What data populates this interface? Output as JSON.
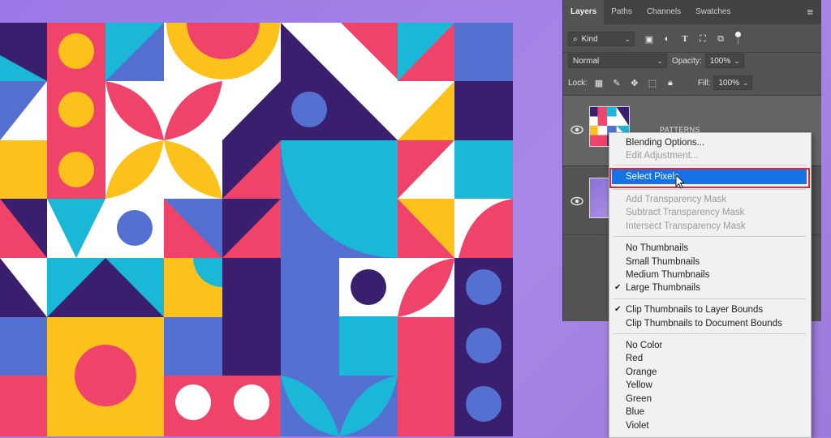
{
  "layers_panel": {
    "tabs": [
      "Layers",
      "Paths",
      "Channels",
      "Swatches"
    ],
    "filter": {
      "label": "Kind"
    },
    "blend_mode": "Normal",
    "opacity": {
      "label": "Opacity:",
      "value": "100%"
    },
    "lock_label": "Lock:",
    "fill": {
      "label": "Fill:",
      "value": "100%"
    },
    "layers": [
      {
        "name": "PATTERNS",
        "visible": true
      },
      {
        "name": "",
        "visible": true
      }
    ]
  },
  "context_menu": {
    "items": [
      {
        "label": "Blending Options...",
        "enabled": true
      },
      {
        "label": "Edit Adjustment...",
        "enabled": false
      },
      {
        "label": "Select Pixels",
        "enabled": true,
        "highlighted": true
      },
      {
        "label": "Add Transparency Mask",
        "enabled": false
      },
      {
        "label": "Subtract Transparency Mask",
        "enabled": false
      },
      {
        "label": "Intersect Transparency Mask",
        "enabled": false
      },
      {
        "label": "No Thumbnails",
        "enabled": true
      },
      {
        "label": "Small Thumbnails",
        "enabled": true
      },
      {
        "label": "Medium Thumbnails",
        "enabled": true
      },
      {
        "label": "Large Thumbnails",
        "enabled": true,
        "checked": true
      },
      {
        "label": "Clip Thumbnails to Layer Bounds",
        "enabled": true,
        "checked": true
      },
      {
        "label": "Clip Thumbnails to Document Bounds",
        "enabled": true
      },
      {
        "label": "No Color",
        "enabled": true
      },
      {
        "label": "Red",
        "enabled": true
      },
      {
        "label": "Orange",
        "enabled": true
      },
      {
        "label": "Yellow",
        "enabled": true
      },
      {
        "label": "Green",
        "enabled": true
      },
      {
        "label": "Blue",
        "enabled": true
      },
      {
        "label": "Violet",
        "enabled": true
      }
    ]
  },
  "colors": {
    "highlight": "#1473e6",
    "highlight_outline": "#e8243b",
    "pattern_pink": "#f0436a",
    "pattern_yellow": "#fcc21b",
    "pattern_cyan": "#1bb7d6",
    "pattern_navy": "#3a1f6e",
    "pattern_blue": "#5470d0",
    "pattern_white": "#ffffff"
  }
}
